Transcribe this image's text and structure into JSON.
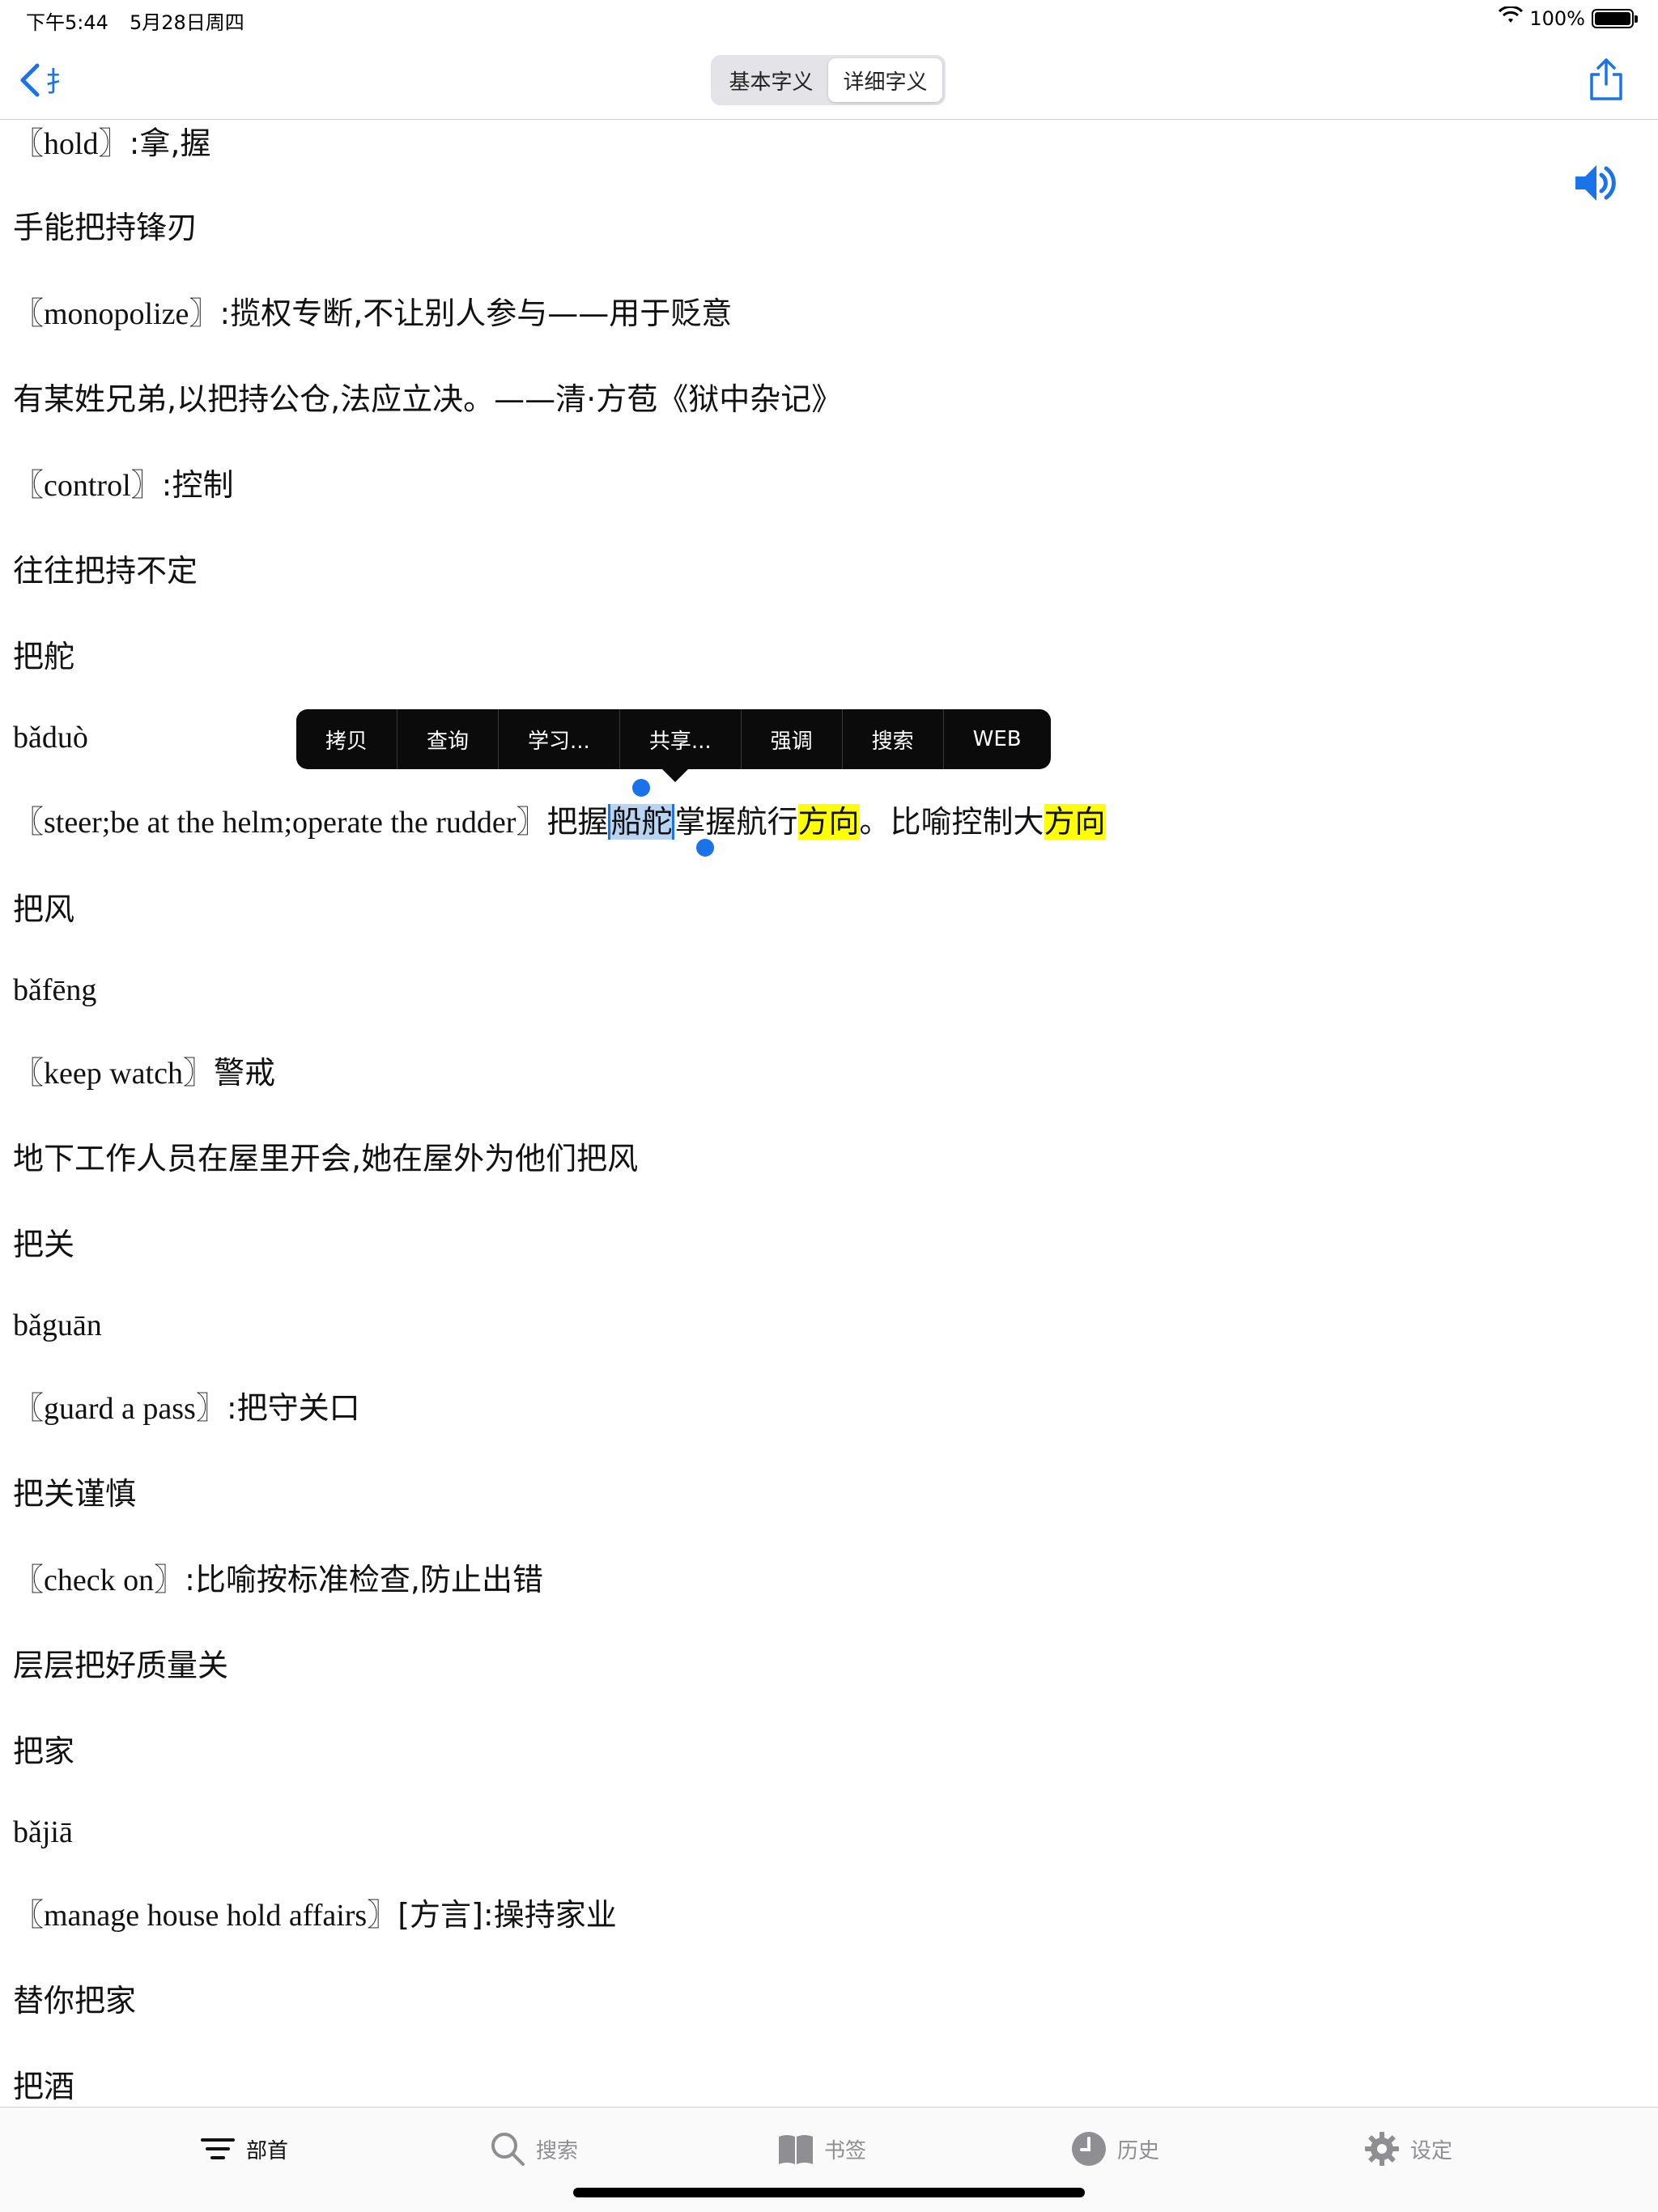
{
  "status_bar": {
    "time": "下午5:44",
    "date": "5月28日周四",
    "battery": "100%",
    "battery_level": 1.0
  },
  "nav": {
    "back_label": "扌",
    "segments": [
      "基本字义",
      "详细字义"
    ],
    "active_segment": 1
  },
  "content": {
    "lines": [
      {
        "en": "〖hold〗",
        "cn": ":拿,握"
      },
      {
        "cn": "手能把持锋刃"
      },
      {
        "en": "〖monopolize〗",
        "cn": ":揽权专断,不让别人参与——用于贬意"
      },
      {
        "cn": "有某姓兄弟,以把持公仓,法应立决。——清·方苞《狱中杂记》"
      },
      {
        "en": "〖control〗",
        "cn": ":控制"
      },
      {
        "cn": "往往把持不定"
      },
      {
        "cn": "把舵"
      },
      {
        "en": "bǎduò"
      },
      {
        "en": "〖steer;be at the helm;operate the rudder〗",
        "cn_a": "把握",
        "cn_sel": "船舵",
        "cn_b": "掌握航行",
        "cn_hl1": "方向",
        "cn_c": "。比喻控制大",
        "cn_hl2": "方向"
      },
      {
        "cn": "把风"
      },
      {
        "en": "bǎfēng"
      },
      {
        "en": "〖keep watch〗",
        "cn": "警戒"
      },
      {
        "cn": "地下工作人员在屋里开会,她在屋外为他们把风"
      },
      {
        "cn": "把关"
      },
      {
        "en": "bǎguān"
      },
      {
        "en": "〖guard a pass〗",
        "cn": ":把守关口"
      },
      {
        "cn": "把关谨慎"
      },
      {
        "en": "〖check on〗",
        "cn": ":比喻按标准检查,防止出错"
      },
      {
        "cn": "层层把好质量关"
      },
      {
        "cn": "把家"
      },
      {
        "en": "bǎjiā"
      },
      {
        "en": "〖manage house hold affairs〗",
        "cn": "[方言]:操持家业"
      },
      {
        "cn": "替你把家"
      },
      {
        "cn": "把酒"
      }
    ]
  },
  "edit_menu": {
    "items": [
      "拷贝",
      "查询",
      "学习...",
      "共享...",
      "强调",
      "搜索",
      "WEB"
    ]
  },
  "tab_bar": {
    "tabs": [
      {
        "label": "部首",
        "icon": "list-filter-icon"
      },
      {
        "label": "搜索",
        "icon": "search-icon"
      },
      {
        "label": "书签",
        "icon": "book-icon"
      },
      {
        "label": "历史",
        "icon": "clock-icon"
      },
      {
        "label": "设定",
        "icon": "gear-icon"
      }
    ],
    "active_tab": 0
  },
  "colors": {
    "accent": "#1a73e8",
    "highlight": "#ffff00",
    "selection": "#b9d4f3"
  }
}
